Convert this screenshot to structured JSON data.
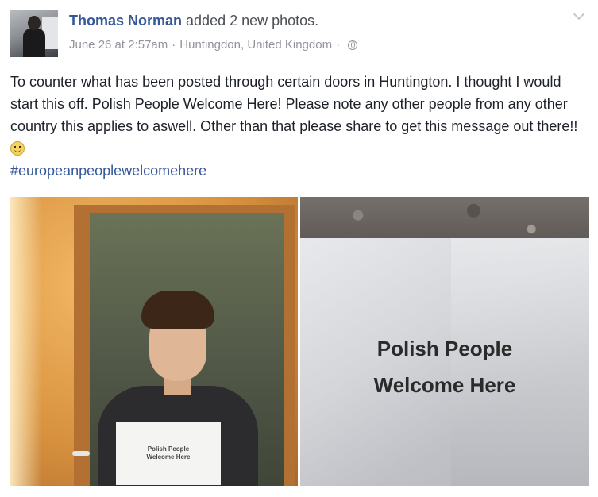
{
  "post": {
    "author": "Thomas Norman",
    "action_prefix": " added ",
    "action_link": "2 new photos",
    "action_suffix": ".",
    "date": "June 26 at 2:57am",
    "separator": "·",
    "location": "Huntingdon, United Kingdom",
    "privacy_icon": "globe-icon",
    "menu_icon": "chevron-down-icon",
    "text": "To counter what has been posted through certain doors in Huntington. I thought I would start this off. Polish People Welcome Here! Please note any other people from any other country this applies to aswell. Other than that please share to get this message out there!!",
    "emoji": "smiley-icon",
    "hashtag": "#europeanpeoplewelcomehere"
  },
  "photos": [
    {
      "sign_line1": "Polish People",
      "sign_line2": "Welcome Here"
    },
    {
      "sign_line1": "Polish People",
      "sign_line2": "Welcome Here"
    }
  ],
  "colors": {
    "link": "#365899",
    "meta": "#90949c",
    "text": "#1d2129"
  }
}
